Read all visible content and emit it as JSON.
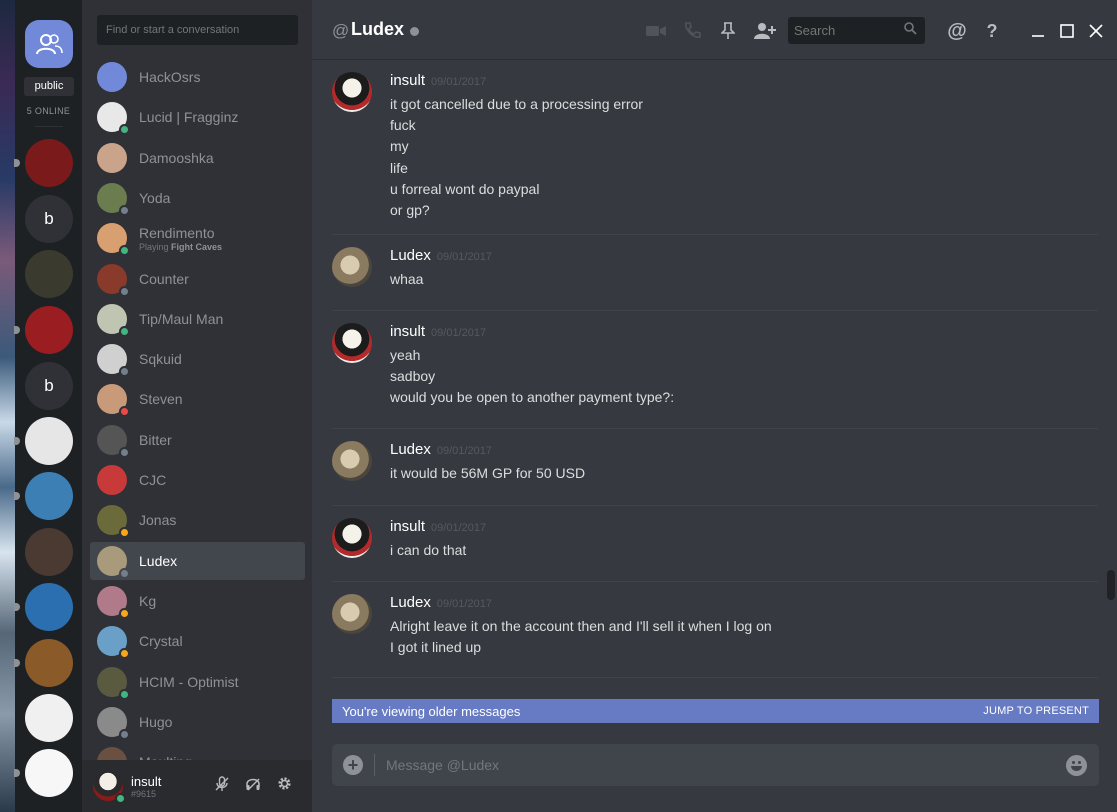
{
  "app": {
    "search_placeholder": "Find or start a conversation",
    "header_label": "Ludex",
    "header_search_placeholder": "Search",
    "public_label": "public",
    "online_label": "5 ONLINE"
  },
  "servers": [
    {
      "letter": "",
      "color": "#7a1a1a",
      "pip": true
    },
    {
      "letter": "b",
      "color": "#2f3136",
      "pip": false
    },
    {
      "letter": "",
      "color": "#3a3b2e",
      "pip": false
    },
    {
      "letter": "",
      "color": "#9a1d22",
      "pip": true
    },
    {
      "letter": "b",
      "color": "#2f3136",
      "pip": false
    },
    {
      "letter": "",
      "color": "#e6e6e6",
      "pip": true
    },
    {
      "letter": "",
      "color": "#3b7fb5",
      "pip": true
    },
    {
      "letter": "",
      "color": "#4a3a32",
      "pip": false
    },
    {
      "letter": "",
      "color": "#2b6fb0",
      "pip": true
    },
    {
      "letter": "",
      "color": "#8a5a28",
      "pip": true
    },
    {
      "letter": "",
      "color": "#f0f0f0",
      "pip": false
    },
    {
      "letter": "",
      "color": "#f7f7f7",
      "pip": true
    }
  ],
  "dm_list": [
    {
      "name": "HackOsrs",
      "sub": "",
      "sub_bold": "",
      "avatar": "#7289da",
      "status": "",
      "selected": false
    },
    {
      "name": "Lucid | Fragginz",
      "sub": "",
      "sub_bold": "",
      "avatar": "#e8e8e8",
      "status": "#43b581",
      "selected": false
    },
    {
      "name": "Damooshka",
      "sub": "",
      "sub_bold": "",
      "avatar": "#c9a48a",
      "status": "",
      "selected": false
    },
    {
      "name": "Yoda",
      "sub": "",
      "sub_bold": "",
      "avatar": "#6b7c4e",
      "status": "#747f8d",
      "selected": false
    },
    {
      "name": "Rendimento",
      "sub": "Playing ",
      "sub_bold": "Fight Caves",
      "avatar": "#d8a070",
      "status": "#43b581",
      "selected": false
    },
    {
      "name": "Counter",
      "sub": "",
      "sub_bold": "",
      "avatar": "#8a3a2a",
      "status": "#747f8d",
      "selected": false
    },
    {
      "name": "Tip/Maul Man",
      "sub": "",
      "sub_bold": "",
      "avatar": "#bfc5b0",
      "status": "#43b581",
      "selected": false
    },
    {
      "name": "Sqkuid",
      "sub": "",
      "sub_bold": "",
      "avatar": "#d0d0d0",
      "status": "#747f8d",
      "selected": false
    },
    {
      "name": "Steven",
      "sub": "",
      "sub_bold": "",
      "avatar": "#c89a7a",
      "status": "#f04747",
      "selected": false
    },
    {
      "name": "Bitter",
      "sub": "",
      "sub_bold": "",
      "avatar": "#555555",
      "status": "#747f8d",
      "selected": false
    },
    {
      "name": "CJC",
      "sub": "",
      "sub_bold": "",
      "avatar": "#c83a3a",
      "status": "",
      "selected": false
    },
    {
      "name": "Jonas",
      "sub": "",
      "sub_bold": "",
      "avatar": "#6a6a3a",
      "status": "#faa61a",
      "selected": false
    },
    {
      "name": "Ludex",
      "sub": "",
      "sub_bold": "",
      "avatar": "#a89a7a",
      "status": "#747f8d",
      "selected": true
    },
    {
      "name": "Kg",
      "sub": "",
      "sub_bold": "",
      "avatar": "#b07a8a",
      "status": "#faa61a",
      "selected": false
    },
    {
      "name": "Crystal",
      "sub": "",
      "sub_bold": "",
      "avatar": "#6aa0c8",
      "status": "#faa61a",
      "selected": false
    },
    {
      "name": "HCIM - Optimist",
      "sub": "",
      "sub_bold": "",
      "avatar": "#5a5a40",
      "status": "#43b581",
      "selected": false
    },
    {
      "name": "Hugo",
      "sub": "",
      "sub_bold": "",
      "avatar": "#8a8a8a",
      "status": "#747f8d",
      "selected": false
    },
    {
      "name": "Maulting",
      "sub": "",
      "sub_bold": "",
      "avatar": "#6a5040",
      "status": "",
      "selected": false
    }
  ],
  "user": {
    "name": "insult",
    "tag": "#9615"
  },
  "messages": [
    {
      "author": "insult",
      "time": "09/01/2017",
      "lines": [
        "it got cancelled due to a processing error",
        "fuck",
        "my",
        "life",
        "u forreal wont do paypal",
        "or gp?"
      ]
    },
    {
      "author": "Ludex",
      "time": "09/01/2017",
      "lines": [
        "whaa"
      ]
    },
    {
      "author": "insult",
      "time": "09/01/2017",
      "lines": [
        "yeah",
        "sadboy",
        "would you be open to another payment type?:"
      ]
    },
    {
      "author": "Ludex",
      "time": "09/01/2017",
      "lines": [
        "it would be 56M GP for 50 USD"
      ]
    },
    {
      "author": "insult",
      "time": "09/01/2017",
      "lines": [
        "i can do that"
      ]
    },
    {
      "author": "Ludex",
      "time": "09/01/2017",
      "lines": [
        "Alright leave it on the account then and I'll sell it when I log on",
        "I got it lined up"
      ]
    }
  ],
  "banner": {
    "left": "You're viewing older messages",
    "right": "JUMP TO PRESENT"
  },
  "composer": {
    "placeholder": "Message @Ludex"
  },
  "colors": {
    "accent": "#7289da",
    "banner": "#677bc4",
    "bg": "#36393f"
  }
}
